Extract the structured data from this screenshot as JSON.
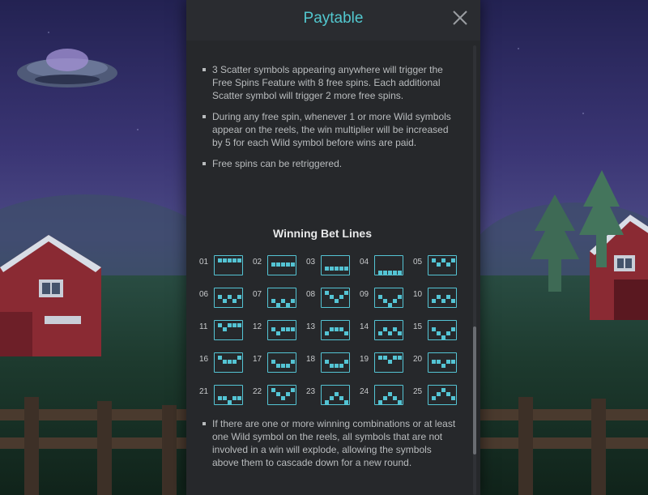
{
  "paytable": {
    "title": "Paytable",
    "close_icon": "close-icon",
    "rules_top": [
      "3 Scatter symbols appearing anywhere will trigger the Free Spins Feature with 8 free spins. Each additional Scatter symbol will trigger 2 more free spins.",
      "During any free spin, whenever 1 or more Wild symbols appear on the reels, the win multiplier will be increased by 5 for each Wild symbol before wins are paid.",
      "Free spins can be retriggered."
    ],
    "winning_lines_title": "Winning Bet Lines",
    "bet_lines": [
      {
        "label": "01",
        "rows": [
          0,
          0,
          0,
          0,
          0
        ]
      },
      {
        "label": "02",
        "rows": [
          1,
          1,
          1,
          1,
          1
        ]
      },
      {
        "label": "03",
        "rows": [
          2,
          2,
          2,
          2,
          2
        ]
      },
      {
        "label": "04",
        "rows": [
          3,
          3,
          3,
          3,
          3
        ]
      },
      {
        "label": "05",
        "rows": [
          0,
          1,
          0,
          1,
          0
        ]
      },
      {
        "label": "06",
        "rows": [
          1,
          2,
          1,
          2,
          1
        ]
      },
      {
        "label": "07",
        "rows": [
          2,
          3,
          2,
          3,
          2
        ]
      },
      {
        "label": "08",
        "rows": [
          0,
          1,
          2,
          1,
          0
        ]
      },
      {
        "label": "09",
        "rows": [
          1,
          2,
          3,
          2,
          1
        ]
      },
      {
        "label": "10",
        "rows": [
          2,
          1,
          2,
          1,
          2
        ]
      },
      {
        "label": "11",
        "rows": [
          0,
          1,
          0,
          0,
          0
        ]
      },
      {
        "label": "12",
        "rows": [
          1,
          2,
          1,
          1,
          1
        ]
      },
      {
        "label": "13",
        "rows": [
          2,
          1,
          1,
          1,
          2
        ]
      },
      {
        "label": "14",
        "rows": [
          2,
          1,
          2,
          1,
          2
        ]
      },
      {
        "label": "15",
        "rows": [
          1,
          2,
          3,
          2,
          1
        ]
      },
      {
        "label": "16",
        "rows": [
          0,
          1,
          1,
          1,
          0
        ]
      },
      {
        "label": "17",
        "rows": [
          1,
          2,
          2,
          2,
          1
        ]
      },
      {
        "label": "18",
        "rows": [
          1,
          2,
          2,
          2,
          1
        ]
      },
      {
        "label": "19",
        "rows": [
          0,
          0,
          1,
          0,
          0
        ]
      },
      {
        "label": "20",
        "rows": [
          1,
          1,
          2,
          1,
          1
        ]
      },
      {
        "label": "21",
        "rows": [
          2,
          2,
          3,
          2,
          2
        ]
      },
      {
        "label": "22",
        "rows": [
          0,
          1,
          2,
          1,
          0
        ]
      },
      {
        "label": "23",
        "rows": [
          3,
          2,
          1,
          2,
          3
        ]
      },
      {
        "label": "24",
        "rows": [
          3,
          2,
          1,
          2,
          3
        ]
      },
      {
        "label": "25",
        "rows": [
          2,
          1,
          0,
          1,
          2
        ]
      }
    ],
    "rules_bottom": [
      "If there are one or more winning combinations or at least one Wild symbol on the reels, all symbols that are not involved in a win will explode, allowing the symbols above them to cascade down for a new round."
    ]
  },
  "colors": {
    "title": "#52c8cf",
    "line_icon": "#54c4d4",
    "panel": "#26282b"
  }
}
